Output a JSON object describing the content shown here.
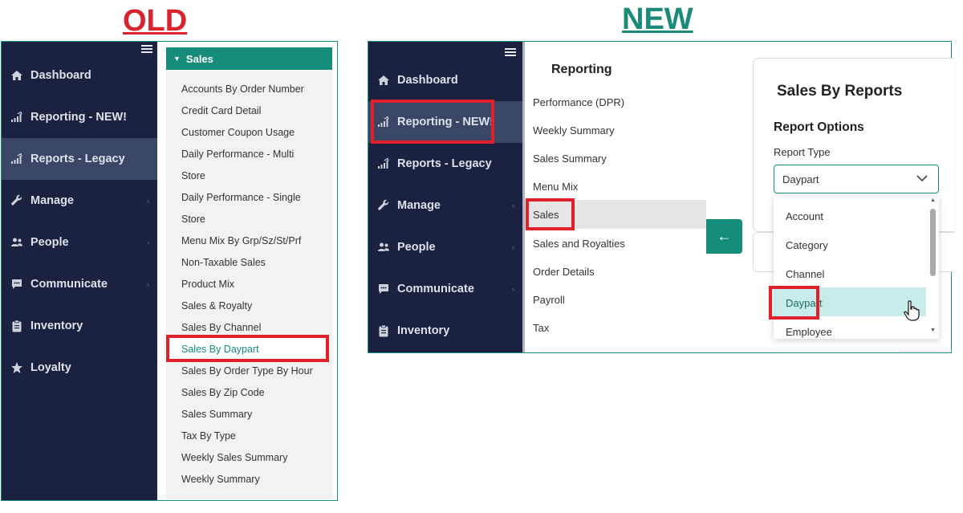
{
  "titles": {
    "old": "OLD",
    "new": "NEW"
  },
  "old": {
    "nav": [
      {
        "label": "Dashboard",
        "icon": "home-icon"
      },
      {
        "label": "Reporting - NEW!",
        "icon": "bar-chart-icon"
      },
      {
        "label": "Reports - Legacy",
        "icon": "bar-chart-icon",
        "active": true
      },
      {
        "label": "Manage",
        "icon": "wrench-icon",
        "chevron": true
      },
      {
        "label": "People",
        "icon": "people-icon",
        "chevron": true
      },
      {
        "label": "Communicate",
        "icon": "chat-icon",
        "chevron": true
      },
      {
        "label": "Inventory",
        "icon": "clipboard-icon"
      },
      {
        "label": "Loyalty",
        "icon": "star-icon"
      }
    ],
    "section_header": "Sales",
    "reports": [
      "Accounts By Order Number",
      "Credit Card Detail",
      "Customer Coupon Usage",
      "Daily Performance - Multi",
      "Store",
      "Daily Performance - Single",
      "Store",
      "Menu Mix By Grp/Sz/St/Prf",
      "Non-Taxable Sales",
      "Product Mix",
      "Sales & Royalty",
      "Sales By Channel",
      "Sales By Daypart",
      "Sales By Order Type By Hour",
      "Sales By Zip Code",
      "Sales Summary",
      "Tax By Type",
      "Weekly Sales Summary",
      "Weekly Summary"
    ],
    "selected_report": "Sales By Daypart"
  },
  "new": {
    "nav": [
      {
        "label": "Dashboard",
        "icon": "home-icon"
      },
      {
        "label": "Reporting - NEW!",
        "icon": "bar-chart-icon",
        "active": true
      },
      {
        "label": "Reports - Legacy",
        "icon": "bar-chart-icon"
      },
      {
        "label": "Manage",
        "icon": "wrench-icon",
        "chevron": true
      },
      {
        "label": "People",
        "icon": "people-icon",
        "chevron": true
      },
      {
        "label": "Communicate",
        "icon": "chat-icon",
        "chevron": true
      },
      {
        "label": "Inventory",
        "icon": "clipboard-icon"
      }
    ],
    "reporting_title": "Reporting",
    "reporting_items": [
      "Performance (DPR)",
      "Weekly Summary",
      "Sales Summary",
      "Menu Mix",
      "Sales",
      "Sales and Royalties",
      "Order Details",
      "Payroll",
      "Tax"
    ],
    "selected_reporting_item": "Sales",
    "card_title": "Sales By Reports",
    "report_options_title": "Report Options",
    "report_type_label": "Report Type",
    "report_type_value": "Daypart",
    "report_type_options": [
      "Account",
      "Category",
      "Channel",
      "Daypart",
      "Employee"
    ],
    "highlighted_option": "Daypart"
  },
  "colors": {
    "sidebar": "#1b2240",
    "accent": "#168c7a",
    "highlight_box": "#e0202b"
  }
}
